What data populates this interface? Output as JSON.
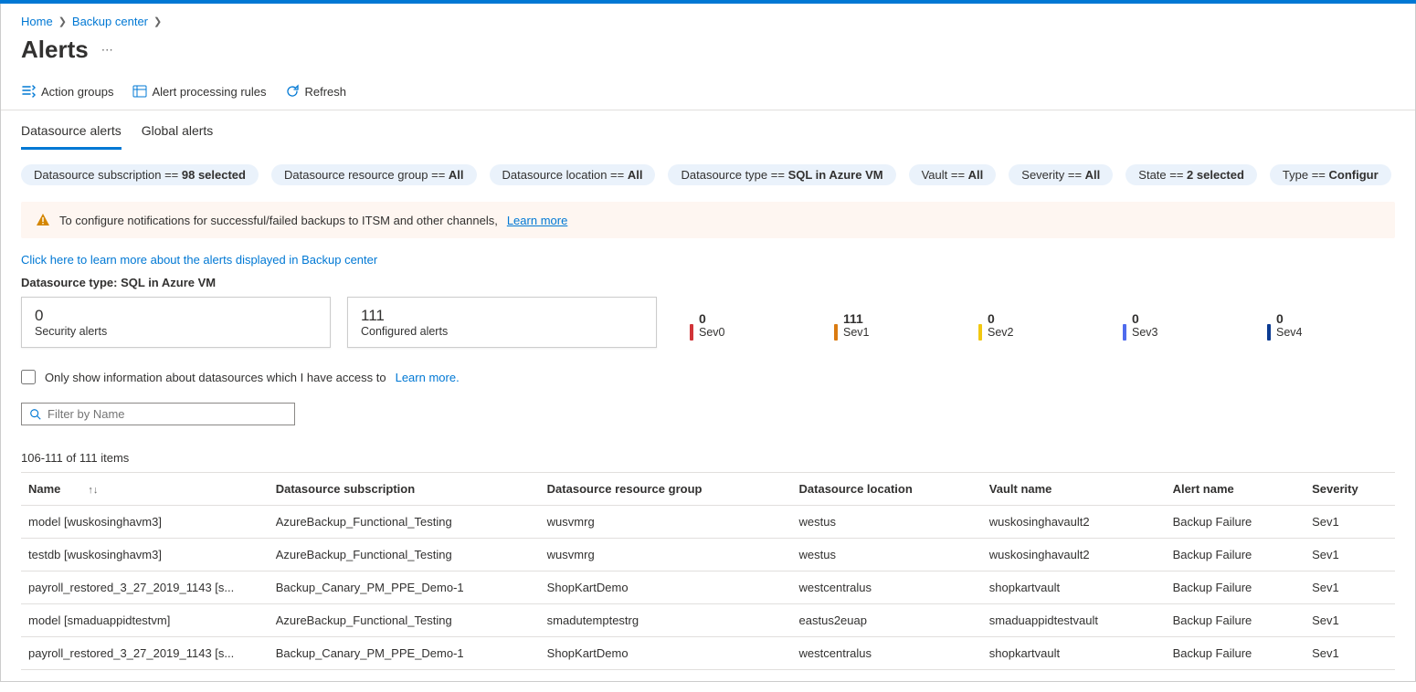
{
  "breadcrumb": {
    "home": "Home",
    "backup_center": "Backup center"
  },
  "page_title": "Alerts",
  "toolbar": {
    "action_groups": "Action groups",
    "alert_rules": "Alert processing rules",
    "refresh": "Refresh"
  },
  "tabs": {
    "datasource": "Datasource alerts",
    "global": "Global alerts"
  },
  "filters": {
    "subscription": {
      "label": "Datasource subscription == ",
      "value": "98 selected"
    },
    "rg": {
      "label": "Datasource resource group == ",
      "value": "All"
    },
    "location": {
      "label": "Datasource location == ",
      "value": "All"
    },
    "type": {
      "label": "Datasource type == ",
      "value": "SQL in Azure VM"
    },
    "vault": {
      "label": "Vault == ",
      "value": "All"
    },
    "severity": {
      "label": "Severity == ",
      "value": "All"
    },
    "state": {
      "label": "State == ",
      "value": "2 selected"
    },
    "type2": {
      "label": "Type == ",
      "value": "Configur"
    }
  },
  "banner": {
    "text": "To configure notifications for successful/failed backups to ITSM and other channels,",
    "link": "Learn more"
  },
  "learn_link": "Click here to learn more about the alerts displayed in Backup center",
  "ds_label": "Datasource type: SQL in Azure VM",
  "summary": {
    "security": {
      "n": "0",
      "lbl": "Security alerts"
    },
    "configured": {
      "n": "111",
      "lbl": "Configured alerts"
    },
    "sev": [
      {
        "n": "0",
        "lbl": "Sev0"
      },
      {
        "n": "111",
        "lbl": "Sev1"
      },
      {
        "n": "0",
        "lbl": "Sev2"
      },
      {
        "n": "0",
        "lbl": "Sev3"
      },
      {
        "n": "0",
        "lbl": "Sev4"
      }
    ]
  },
  "checkbox_row": {
    "text": "Only show information about datasources which I have access to",
    "link": "Learn more."
  },
  "filter_placeholder": "Filter by Name",
  "count_text": "106-111 of 111 items",
  "headers": {
    "name": "Name",
    "sub": "Datasource subscription",
    "rg": "Datasource resource group",
    "loc": "Datasource location",
    "vault": "Vault name",
    "alert": "Alert name",
    "sev": "Severity"
  },
  "rows": [
    {
      "name": "model [wuskosinghavm3]",
      "sub": "AzureBackup_Functional_Testing",
      "rg": "wusvmrg",
      "loc": "westus",
      "vault": "wuskosinghavault2",
      "alert": "Backup Failure",
      "sev": "Sev1"
    },
    {
      "name": "testdb [wuskosinghavm3]",
      "sub": "AzureBackup_Functional_Testing",
      "rg": "wusvmrg",
      "loc": "westus",
      "vault": "wuskosinghavault2",
      "alert": "Backup Failure",
      "sev": "Sev1"
    },
    {
      "name": "payroll_restored_3_27_2019_1143 [s...",
      "sub": "Backup_Canary_PM_PPE_Demo-1",
      "rg": "ShopKartDemo",
      "loc": "westcentralus",
      "vault": "shopkartvault",
      "alert": "Backup Failure",
      "sev": "Sev1"
    },
    {
      "name": "model [smaduappidtestvm]",
      "sub": "AzureBackup_Functional_Testing",
      "rg": "smadutemptestrg",
      "loc": "eastus2euap",
      "vault": "smaduappidtestvault",
      "alert": "Backup Failure",
      "sev": "Sev1"
    },
    {
      "name": "payroll_restored_3_27_2019_1143 [s...",
      "sub": "Backup_Canary_PM_PPE_Demo-1",
      "rg": "ShopKartDemo",
      "loc": "westcentralus",
      "vault": "shopkartvault",
      "alert": "Backup Failure",
      "sev": "Sev1"
    }
  ]
}
